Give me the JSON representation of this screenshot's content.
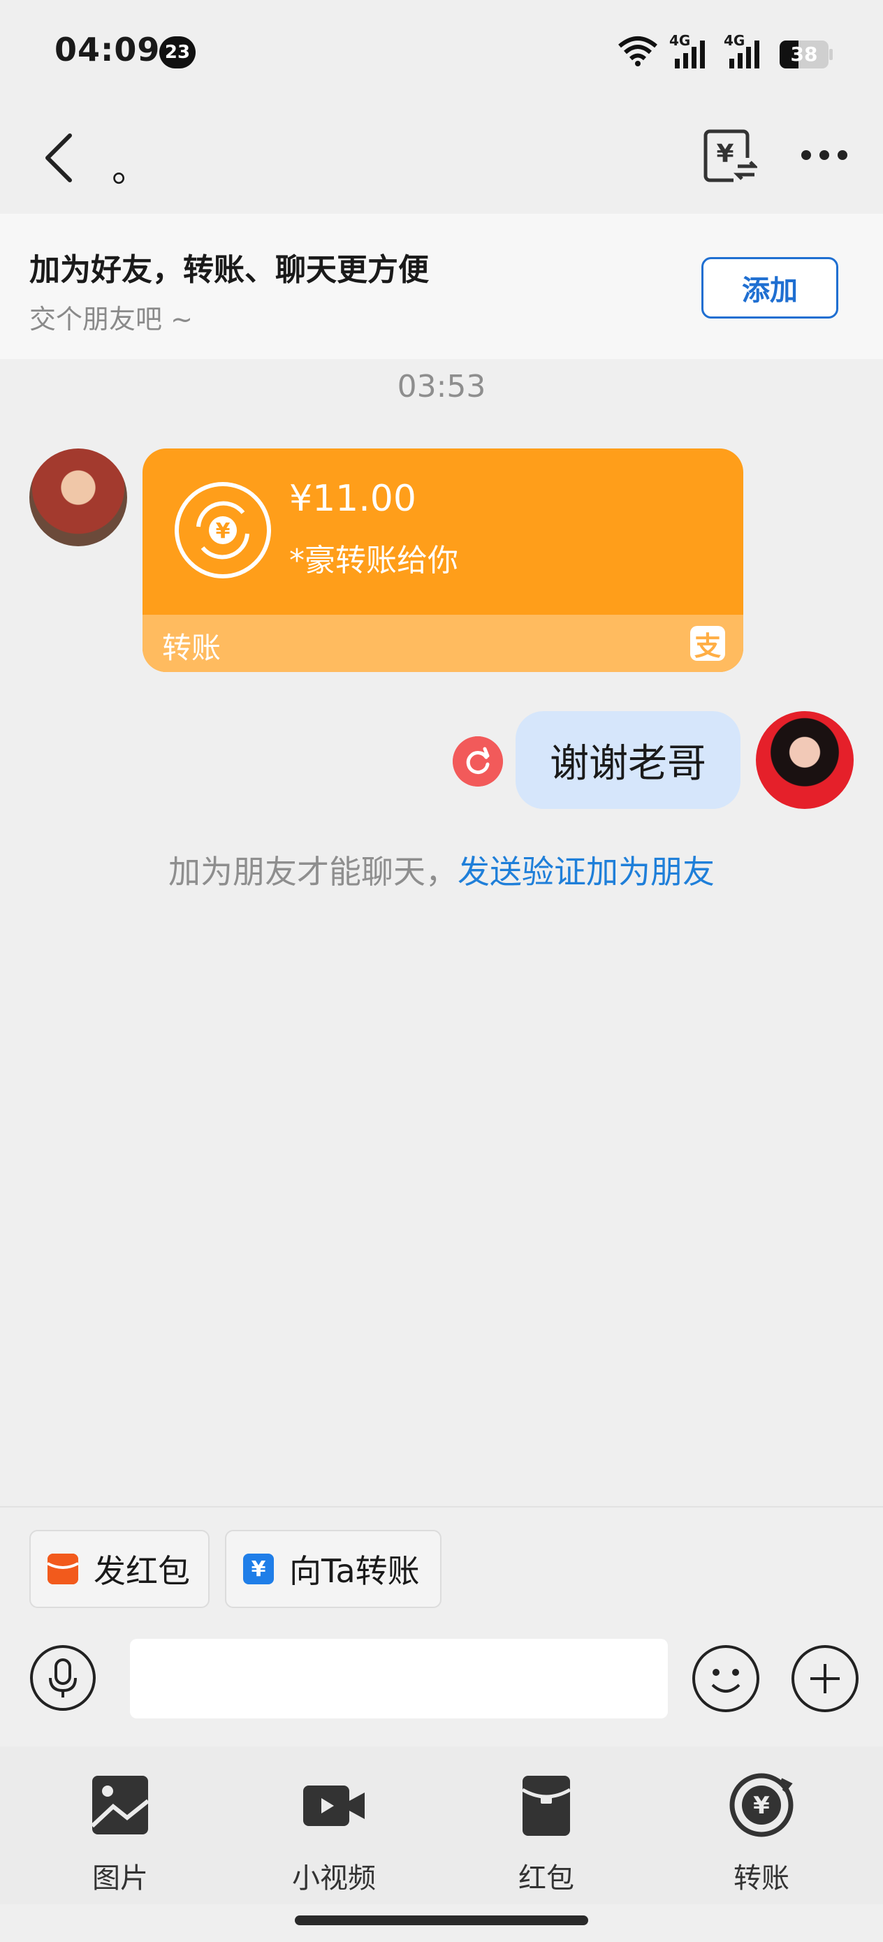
{
  "status_bar": {
    "time": "04:09",
    "notification_count": "23",
    "network_1": "4G",
    "network_2": "4G",
    "battery": "38"
  },
  "header": {
    "title": "。"
  },
  "friend_banner": {
    "title": "加为好友，转账、聊天更方便",
    "subtitle": "交个朋友吧 ~",
    "add_label": "添加"
  },
  "chat": {
    "timestamp": "03:53",
    "transfer": {
      "amount": "¥11.00",
      "description": "*豪转账给你",
      "footer_label": "转账",
      "brand_mark": "支",
      "accent": "#ff9e1a"
    },
    "my_message": "谢谢老哥",
    "hint_prefix": "加为朋友才能聊天，",
    "hint_link": "发送验证加为朋友"
  },
  "quick_actions": {
    "red_packet": "发红包",
    "transfer_to": "向Ta转账"
  },
  "input": {
    "placeholder": "",
    "value": ""
  },
  "tools": [
    {
      "label": "图片",
      "icon": "image-icon"
    },
    {
      "label": "小视频",
      "icon": "video-icon"
    },
    {
      "label": "红包",
      "icon": "red-packet-icon"
    },
    {
      "label": "转账",
      "icon": "transfer-icon"
    }
  ]
}
